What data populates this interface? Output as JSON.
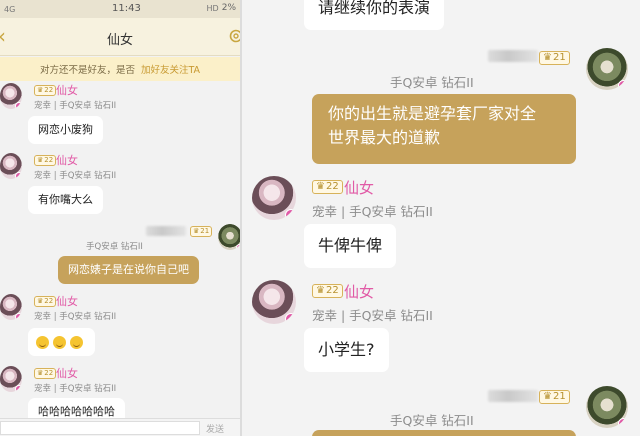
{
  "status_bar": {
    "network": "4G",
    "time": "11:43",
    "hd": "HD",
    "battery": "2%"
  },
  "header": {
    "title": "仙女"
  },
  "banner": {
    "text": "对方还不是好友，是否",
    "link": "加好友关注TA"
  },
  "left_messages": [
    {
      "name": "仙女",
      "level": "22",
      "meta": "宠幸 | 手Q安卓 钻石II",
      "text": "网恋小废狗"
    },
    {
      "name": "仙女",
      "level": "22",
      "meta": "宠幸 | 手Q安卓 钻石II",
      "text": "有你嘴大么"
    },
    {
      "level": "21",
      "meta": "手Q安卓 钻石II",
      "text": "网恋婊子是在说你自己吧"
    },
    {
      "name": "仙女",
      "level": "22",
      "meta": "宠幸 | 手Q安卓 钻石II",
      "text": "",
      "emoji_count": 3
    },
    {
      "name": "仙女",
      "level": "22",
      "meta": "宠幸 | 手Q安卓 钻石II",
      "text": "哈哈哈哈哈哈哈"
    }
  ],
  "input_bar": {
    "send_label": "发送"
  },
  "right_messages": [
    {
      "text": "请继续你的表演"
    },
    {
      "level": "21",
      "meta": "手Q安卓 钻石II",
      "text_line1": "你的出生就是避孕套厂家对全",
      "text_line2": "世界最大的道歉"
    },
    {
      "name": "仙女",
      "level": "22",
      "meta": "宠幸 | 手Q安卓 钻石II",
      "text": "牛俾牛俾"
    },
    {
      "name": "仙女",
      "level": "22",
      "meta": "宠幸 | 手Q安卓 钻石II",
      "text": "小学生?"
    },
    {
      "level": "21",
      "meta": "手Q安卓 钻石II"
    }
  ],
  "colors": {
    "accent_gold": "#c6a25b",
    "name_pink": "#e15aa6",
    "banner_bg": "#fbf0c9"
  }
}
